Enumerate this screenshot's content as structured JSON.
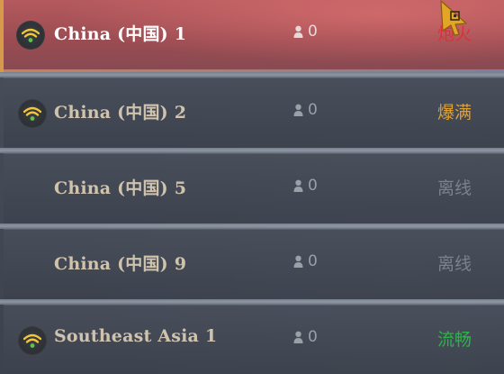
{
  "servers": [
    {
      "name": "China (中国) 1",
      "players": "0",
      "status": "炮火",
      "status_color": "#d9323a",
      "selected": true,
      "signal": true
    },
    {
      "name": "China (中国) 2",
      "players": "0",
      "status": "爆满",
      "status_color": "#e0a030",
      "selected": false,
      "signal": true
    },
    {
      "name": "China (中国) 5",
      "players": "0",
      "status": "离线",
      "status_color": "#7c828c",
      "selected": false,
      "signal": false
    },
    {
      "name": "China (中国) 9",
      "players": "0",
      "status": "离线",
      "status_color": "#7c828c",
      "selected": false,
      "signal": false
    },
    {
      "name": "Southeast Asia 1",
      "players": "0",
      "status": "流畅",
      "status_color": "#2fb24a",
      "selected": false,
      "signal": true
    }
  ],
  "icons": {
    "signal": "wifi-signal-icon",
    "player": "player-person-icon",
    "cursor": "mouse-cursor-icon"
  },
  "colors": {
    "signal_arc": "#f2c63a",
    "signal_dot": "#5ec24c"
  }
}
